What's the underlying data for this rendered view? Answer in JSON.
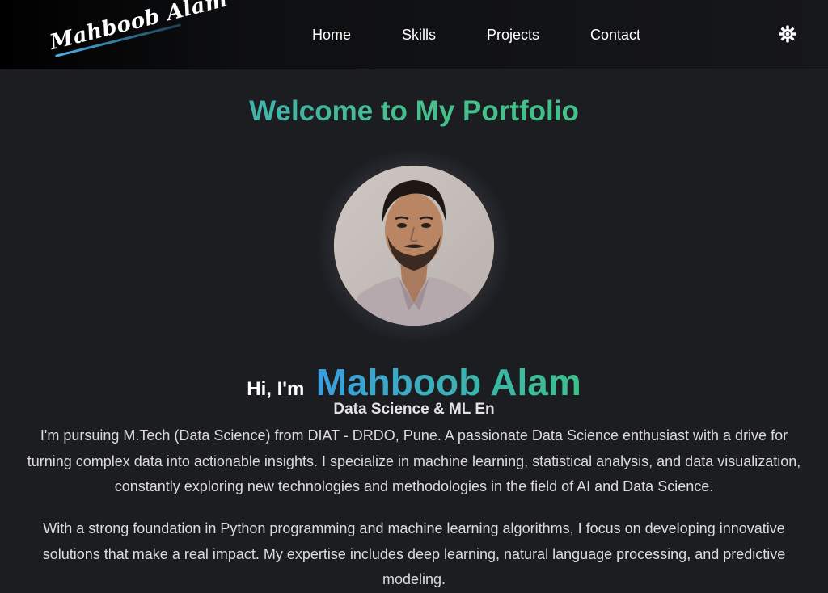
{
  "logo": {
    "text": "Mahboob Alam"
  },
  "nav": {
    "links": [
      {
        "label": "Home"
      },
      {
        "label": "Skills"
      },
      {
        "label": "Projects"
      },
      {
        "label": "Contact"
      }
    ],
    "theme_toggle_icon": "sun-gear-icon"
  },
  "hero": {
    "welcome": "Welcome to My Portfolio",
    "greeting": "Hi, I'm",
    "name": "Mahboob Alam",
    "role": "Data Science & ML En",
    "paragraphs": [
      "I'm pursuing M.Tech (Data Science) from DIAT - DRDO, Pune. A passionate Data Science enthusiast with a drive for turning complex data into actionable insights. I specialize in machine learning, statistical analysis, and data visualization, constantly exploring new technologies and methodologies in the field of AI and Data Science.",
      "With a strong foundation in Python programming and machine learning algorithms, I focus on developing innovative solutions that make a real impact. My expertise includes deep learning, natural language processing, and predictive modeling."
    ]
  },
  "colors": {
    "background": "#1c1d21",
    "accent_blue": "#3a9ee0",
    "accent_green": "#3cc28a"
  }
}
